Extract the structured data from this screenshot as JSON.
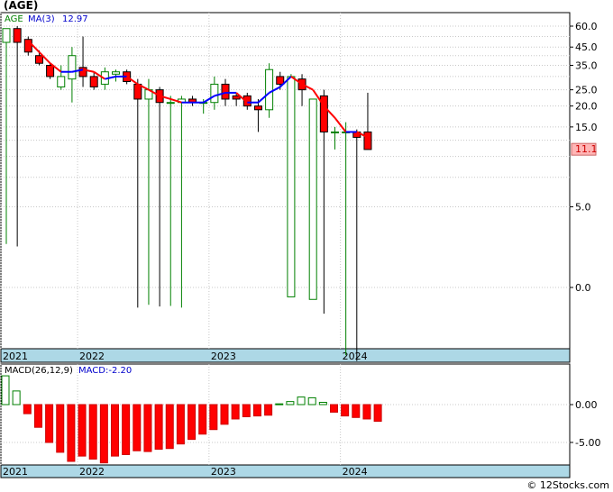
{
  "title": "(AGE)",
  "watermark": "© 12Stocks.com",
  "colors": {
    "up": "#ffffff",
    "up_border": "#008000",
    "down": "#ff0000",
    "down_border": "#000000",
    "ma_up": "#0000ff",
    "ma_down": "#ff0000",
    "axis_band": "#add8e6",
    "grid": "#c8c8c8",
    "last_price_bg": "#ffb6b6"
  },
  "chart_data": [
    {
      "type": "candlestick",
      "scale": "log",
      "legend": {
        "symbol": "AGE",
        "ma_label": "MA(3)",
        "ma_value": "12.97"
      },
      "y_ticks": [
        "60.0",
        "45.0",
        "35.0",
        "25.0",
        "20.0",
        "15.0",
        "5.0",
        "0.0"
      ],
      "y_tick_values": [
        60,
        45,
        35,
        25,
        20,
        15,
        5,
        1.65
      ],
      "last_price": "11.1",
      "last_price_value": 11.1,
      "x_labels": [
        "2021",
        "2022",
        "2023",
        "2024"
      ],
      "x_label_positions": [
        0,
        7,
        19,
        31
      ],
      "candles": [
        {
          "o": 48,
          "h": 58,
          "l": 3.0,
          "c": 58
        },
        {
          "o": 58,
          "h": 60,
          "l": 2.9,
          "c": 48
        },
        {
          "o": 50,
          "h": 52,
          "l": 40,
          "c": 42
        },
        {
          "o": 40,
          "h": 43,
          "l": 35,
          "c": 36
        },
        {
          "o": 35,
          "h": 36,
          "l": 29,
          "c": 30
        },
        {
          "o": 26,
          "h": 35,
          "l": 25,
          "c": 30
        },
        {
          "o": 29,
          "h": 45,
          "l": 21,
          "c": 40
        },
        {
          "o": 34,
          "h": 52,
          "l": 26,
          "c": 30
        },
        {
          "o": 30,
          "h": 32,
          "l": 25,
          "c": 26
        },
        {
          "o": 27,
          "h": 34,
          "l": 25,
          "c": 32
        },
        {
          "o": 31,
          "h": 33,
          "l": 28,
          "c": 32
        },
        {
          "o": 32,
          "h": 33,
          "l": 27,
          "c": 28
        },
        {
          "o": 27,
          "h": 29,
          "l": 1.25,
          "c": 22
        },
        {
          "o": 22,
          "h": 29,
          "l": 1.3,
          "c": 25
        },
        {
          "o": 25,
          "h": 26,
          "l": 1.27,
          "c": 21
        },
        {
          "o": 21,
          "h": 23,
          "l": 1.28,
          "c": 21
        },
        {
          "o": 21,
          "h": 23,
          "l": 1.25,
          "c": 22
        },
        {
          "o": 22,
          "h": 23,
          "l": 20,
          "c": 21
        },
        {
          "o": 21,
          "h": 22,
          "l": 18,
          "c": 21
        },
        {
          "o": 21,
          "h": 30,
          "l": 19,
          "c": 27
        },
        {
          "o": 27,
          "h": 29,
          "l": 20,
          "c": 22
        },
        {
          "o": 23,
          "h": 24,
          "l": 20,
          "c": 22
        },
        {
          "o": 23,
          "h": 24,
          "l": 19,
          "c": 20
        },
        {
          "o": 20,
          "h": 22,
          "l": 14,
          "c": 19
        },
        {
          "o": 19,
          "h": 36,
          "l": 17,
          "c": 33
        },
        {
          "o": 30,
          "h": 32,
          "l": 25,
          "c": 27
        },
        {
          "o": 1.45,
          "h": 31,
          "l": 1.45,
          "c": 30
        },
        {
          "o": 29,
          "h": 31,
          "l": 20,
          "c": 25
        },
        {
          "o": 1.4,
          "h": 22,
          "l": 1.4,
          "c": 22
        },
        {
          "o": 23,
          "h": 25,
          "l": 1.15,
          "c": 14
        },
        {
          "o": 14,
          "h": 15,
          "l": 11,
          "c": 14
        },
        {
          "o": 14,
          "h": 16,
          "l": 0.65,
          "c": 14
        },
        {
          "o": 14,
          "h": 14.5,
          "l": 0.6,
          "c": 13
        },
        {
          "o": 14,
          "h": 24,
          "l": 11,
          "c": 11
        }
      ],
      "ma": [
        null,
        null,
        49,
        42,
        36,
        32,
        32,
        33,
        32,
        29,
        30,
        30,
        27,
        25,
        23,
        22,
        21,
        21,
        21,
        23,
        24,
        24,
        21,
        21,
        24,
        26,
        30,
        27,
        25,
        20,
        17,
        14,
        14,
        13
      ]
    },
    {
      "type": "bar",
      "legend": {
        "label": "MACD(26,12,9)",
        "value_label": "MACD:-2.20"
      },
      "y_ticks": [
        "0.00",
        "-5.00"
      ],
      "y_tick_values": [
        0,
        -5
      ],
      "x_labels": [
        "2021",
        "2022",
        "2023",
        "2024"
      ],
      "x_label_positions": [
        0,
        7,
        19,
        31
      ],
      "values": [
        3.8,
        1.8,
        -1.2,
        -3.0,
        -5.0,
        -6.3,
        -7.5,
        -6.8,
        -7.2,
        -7.7,
        -6.8,
        -6.6,
        -6.1,
        -6.2,
        -5.9,
        -5.8,
        -5.2,
        -4.6,
        -3.9,
        -3.3,
        -2.6,
        -1.9,
        -1.6,
        -1.5,
        -1.4,
        0.1,
        0.4,
        1.0,
        0.9,
        0.3,
        -1.0,
        -1.5,
        -1.7,
        -1.9,
        -2.2
      ]
    }
  ]
}
